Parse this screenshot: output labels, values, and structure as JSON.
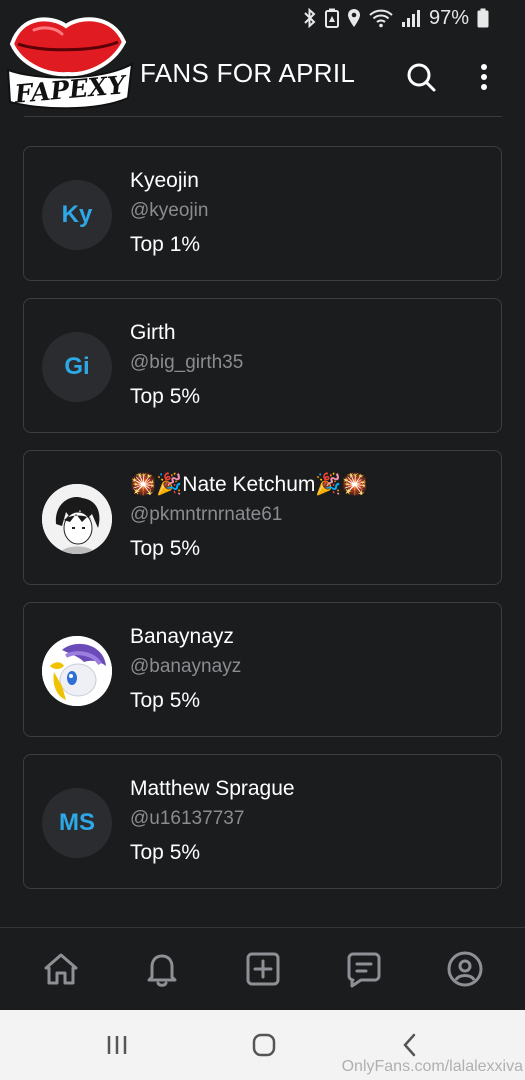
{
  "status_bar": {
    "battery_text": "97%",
    "icons": [
      "bluetooth-icon",
      "battery-saver-icon",
      "location-icon",
      "wifi-icon",
      "signal-icon",
      "battery-icon"
    ]
  },
  "header": {
    "logo_text": "FAPEXY",
    "title": "FANS FOR APRIL",
    "search_icon": "search-icon",
    "more_icon": "more-vertical-icon"
  },
  "fans": [
    {
      "initials": "Ky",
      "name": "Kyeojin",
      "handle": "@kyeojin",
      "rank": "Top 1%"
    },
    {
      "initials": "Gi",
      "name": "Girth",
      "handle": "@big_girth35",
      "rank": "Top 5%"
    },
    {
      "initials": "",
      "name": "🎇🎉Nate Ketchum🎉🎇",
      "handle": "@pkmntrnrnate61",
      "rank": "Top 5%"
    },
    {
      "initials": "",
      "name": "Banaynayz",
      "handle": "@banaynayz",
      "rank": "Top 5%"
    },
    {
      "initials": "MS",
      "name": "Matthew Sprague",
      "handle": "@u16137737",
      "rank": "Top 5%"
    }
  ],
  "bottom_nav": [
    "home-icon",
    "bell-icon",
    "add-post-icon",
    "messages-icon",
    "profile-icon"
  ],
  "watermark": "OnlyFans.com/lalalexxiva",
  "colors": {
    "background": "#1b1c1e",
    "accent": "#2ea9e8",
    "logo_red": "#e11b22"
  }
}
